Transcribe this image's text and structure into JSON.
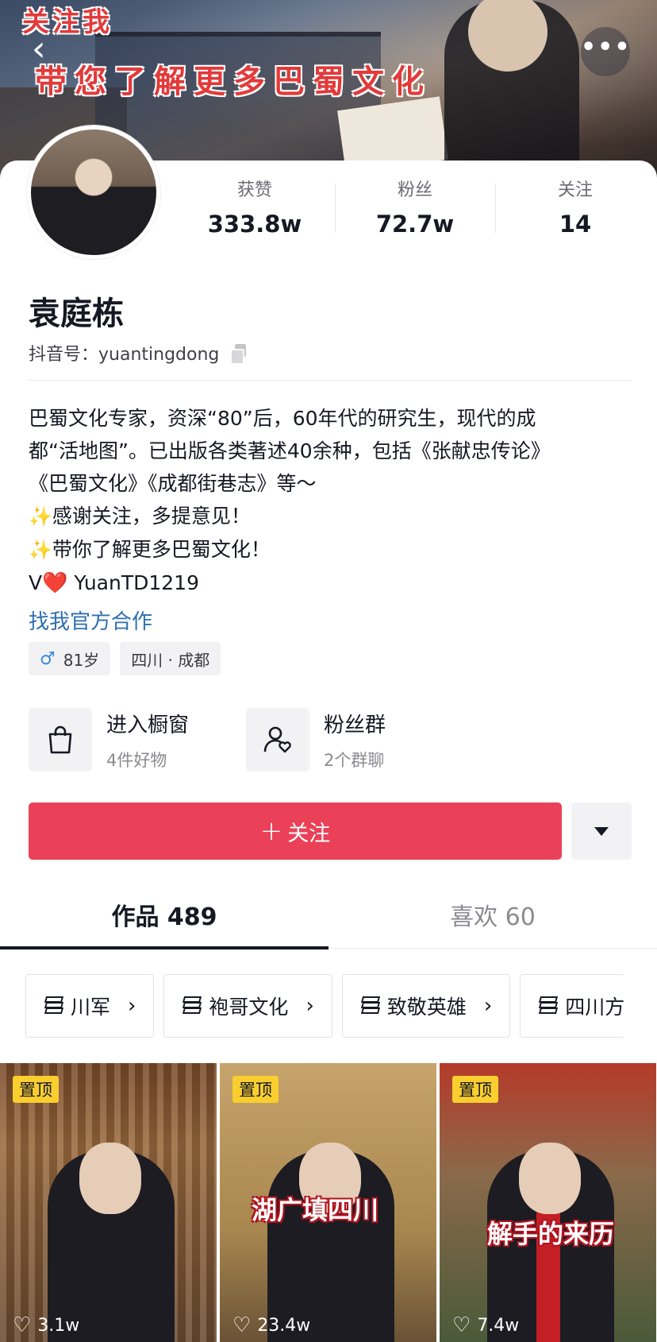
{
  "banner": {
    "line1": "关注我",
    "line2": "带您了解更多巴蜀文化"
  },
  "nav": {
    "back_symbol": "‹",
    "more_symbol": "•••"
  },
  "stats": [
    {
      "label": "获赞",
      "value": "333.8w"
    },
    {
      "label": "粉丝",
      "value": "72.7w"
    },
    {
      "label": "关注",
      "value": "14"
    }
  ],
  "profile": {
    "name": "袁庭栋",
    "douyin_id": "抖音号：yuantingdong"
  },
  "bio": {
    "lines": [
      "巴蜀文化专家，资深“80”后，60年代的研究生，现代的成",
      "都“活地图”。已出版各类著述40余种，包括《张献忠传论》",
      "《巴蜀文化》《成都街巷志》等～",
      "感谢关注，多提意见！",
      "带你了解更多巴蜀文化！",
      " YuanTD1219"
    ],
    "sparkle": "✨",
    "v_prefix": "V",
    "heart": "❤️",
    "link": "找我官方合作"
  },
  "tags": {
    "age": "81岁",
    "location": "四川 · 成都"
  },
  "shortcuts": [
    {
      "title": "进入橱窗",
      "subtitle": "4件好物",
      "icon": "shopping-bag-icon"
    },
    {
      "title": "粉丝群",
      "subtitle": "2个群聊",
      "icon": "group-heart-icon"
    }
  ],
  "actions": {
    "follow": "关注",
    "plus": "+"
  },
  "tabs": [
    {
      "label": "作品 489",
      "active": true
    },
    {
      "label": "喜欢 60",
      "active": false
    }
  ],
  "collections": [
    "川军",
    "袍哥文化",
    "致敬英雄",
    "四川方"
  ],
  "videos": [
    {
      "pinned": "置顶",
      "caption": "",
      "likes": "3.1w"
    },
    {
      "pinned": "置顶",
      "caption": "湖广填四川",
      "likes": "23.4w"
    },
    {
      "pinned": "置顶",
      "caption": "解手的来历",
      "likes": "7.4w"
    }
  ],
  "colors": {
    "accent": "#ea4158",
    "link": "#2f6fb0",
    "pin": "#f9ce2e"
  }
}
